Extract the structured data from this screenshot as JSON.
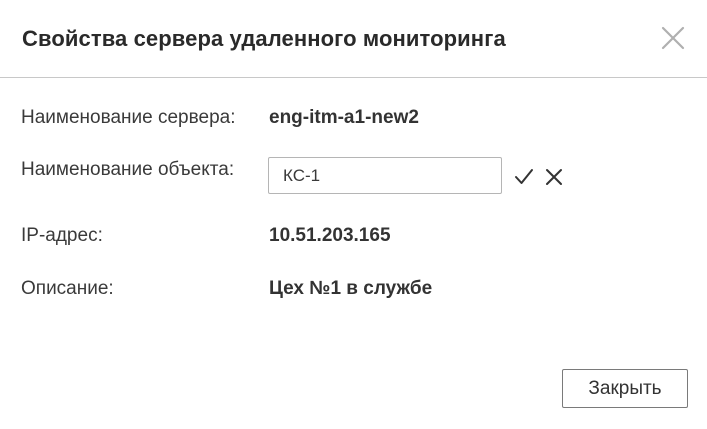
{
  "dialog": {
    "title": "Свойства сервера удаленного мониторинга"
  },
  "fields": {
    "server_name": {
      "label": "Наименование сервера:",
      "value": "eng-itm-a1-new2"
    },
    "object_name": {
      "label": "Наименование объекта:",
      "value": "КС-1"
    },
    "ip": {
      "label": "IP-адрес:",
      "value": "10.51.203.165"
    },
    "description": {
      "label": "Описание:",
      "value": "Цех №1 в службе"
    }
  },
  "footer": {
    "close_label": "Закрыть"
  },
  "icons": {
    "dialog_close": "close-icon",
    "confirm": "check-icon",
    "cancel": "cancel-icon"
  }
}
